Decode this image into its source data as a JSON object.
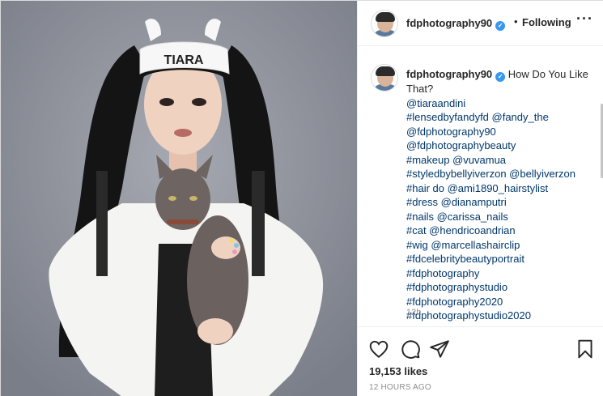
{
  "photo": {
    "headband_text": "TIARA",
    "alt": "Model in white headband holding a sphynx cat"
  },
  "header": {
    "username": "fdphotography90",
    "verified_icon": "verified-badge-icon",
    "separator": "•",
    "follow_state": "Following",
    "more_icon": "···"
  },
  "caption": {
    "username": "fdphotography90",
    "text": "How Do You Like That?",
    "tags": [
      "@tiaraandini",
      "#lensedbyfandyfd @fandy_the",
      "@fdphotography90",
      "@fdphotographybeauty",
      "#makeup @vuvamua",
      "#styledbybellyiverzon @bellyiverzon",
      "#hair do @ami1890_hairstylist",
      "#dress @dianamputri",
      "#nails @carissa_nails",
      "#cat @hendricoandrian",
      "#wig @marcellashairclip",
      "#fdcelebritybeautyportrait",
      "#fdphotography",
      "#fdphotographystudio",
      "#fdphotography2020",
      "#fdphotographystudio2020"
    ],
    "time_ago": "12h"
  },
  "actions": {
    "like_icon": "heart-icon",
    "comment_icon": "comment-icon",
    "share_icon": "share-icon",
    "save_icon": "bookmark-icon",
    "likes": "19,153 likes",
    "posted": "12 HOURS AGO"
  },
  "colors": {
    "link": "#00376b",
    "verified": "#3897f0",
    "muted": "#8e8e8e",
    "photo_bg": "#8e929c"
  }
}
